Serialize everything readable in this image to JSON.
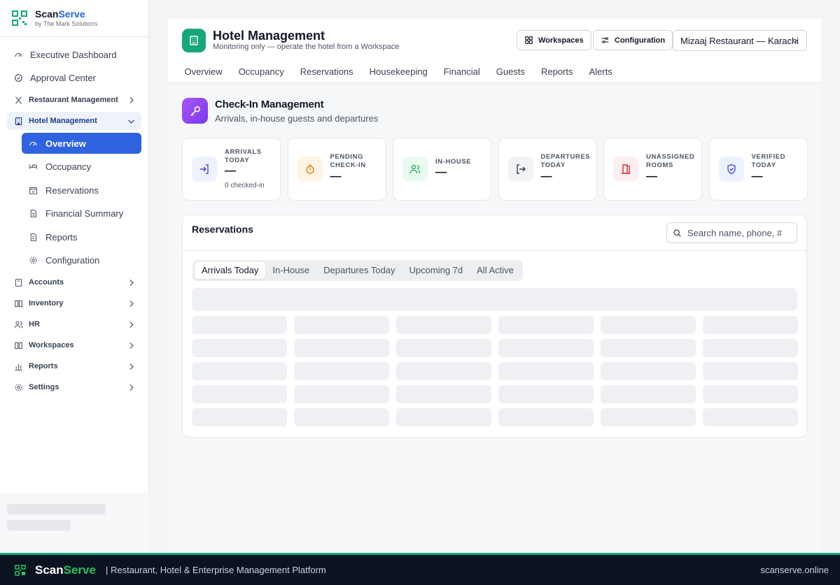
{
  "brand": {
    "name_prefix": "Scan",
    "name_suffix": "Serve",
    "sub": "by The Mark Solutions"
  },
  "sidebar": {
    "top_items": [
      {
        "label": "Executive Dashboard",
        "icon": "gauge-icon"
      },
      {
        "label": "Approval Center",
        "icon": "check-circle-icon"
      }
    ],
    "restaurant": {
      "label": "Restaurant Management",
      "icon": "utensils-icon"
    },
    "hotel": {
      "label": "Hotel Management",
      "icon": "building-icon",
      "items": [
        {
          "label": "Overview",
          "icon": "gauge-icon",
          "active": true
        },
        {
          "label": "Occupancy",
          "icon": "bed-icon"
        },
        {
          "label": "Reservations",
          "icon": "calendar-icon"
        },
        {
          "label": "Financial Summary",
          "icon": "file-icon"
        },
        {
          "label": "Reports",
          "icon": "document-icon"
        },
        {
          "label": "Configuration",
          "icon": "gear-icon"
        }
      ]
    },
    "groups": [
      {
        "label": "Accounts",
        "icon": "book-icon"
      },
      {
        "label": "Inventory",
        "icon": "open-book-icon"
      },
      {
        "label": "HR",
        "icon": "users-icon"
      },
      {
        "label": "Workspaces",
        "icon": "book-icon"
      },
      {
        "label": "Reports",
        "icon": "chart-icon"
      },
      {
        "label": "Settings",
        "icon": "gear-icon"
      }
    ]
  },
  "header": {
    "title": "Hotel Management",
    "subtitle": "Monitoring only — operate the hotel from a Workspace",
    "workspaces_label": "Workspaces",
    "configuration_label": "Configuration",
    "outlet_selected": "Mizaaj Restaurant — Karachi",
    "tabs": [
      "Overview",
      "Occupancy",
      "Reservations",
      "Housekeeping",
      "Financial",
      "Guests",
      "Reports",
      "Alerts"
    ]
  },
  "section": {
    "title": "Check-In Management",
    "subtitle": "Arrivals, in-house guests and departures"
  },
  "stats": [
    {
      "label": "ARRIVALS TODAY",
      "value": "—",
      "note": "0 checked-in",
      "icon": "login-icon",
      "color": "#4f46e5",
      "bg": "#eef2ff"
    },
    {
      "label": "PENDING CHECK-IN",
      "value": "—",
      "note": "",
      "icon": "stopwatch-icon",
      "color": "#ea7a0c",
      "bg": "#fff4e6"
    },
    {
      "label": "IN-HOUSE",
      "value": "—",
      "note": "",
      "icon": "users-icon",
      "color": "#16a34a",
      "bg": "#eafaf0"
    },
    {
      "label": "DEPARTURES TODAY",
      "value": "—",
      "note": "",
      "icon": "logout-icon",
      "color": "#374151",
      "bg": "#f1f3f5"
    },
    {
      "label": "UNASSIGNED ROOMS",
      "value": "—",
      "note": "",
      "icon": "door-icon",
      "color": "#dc2626",
      "bg": "#fdeef0"
    },
    {
      "label": "VERIFIED TODAY",
      "value": "—",
      "note": "",
      "icon": "shield-check-icon",
      "color": "#4f46e5",
      "bg": "#eef2ff"
    }
  ],
  "reservations": {
    "title": "Reservations",
    "search_placeholder": "Search name, phone, #",
    "filters": [
      "Arrivals Today",
      "In-House",
      "Departures Today",
      "Upcoming 7d",
      "All Active"
    ],
    "active_filter": "Arrivals Today"
  },
  "footer": {
    "brand_prefix": "Scan",
    "brand_suffix": "Serve",
    "tagline": "| Restaurant, Hotel & Enterprise Management Platform",
    "url": "scanserve.online"
  },
  "colors": {
    "primary": "#2f63e0",
    "green": "#16a77a",
    "purple": "#8b5cf6",
    "footer_bg": "#0b1220"
  }
}
